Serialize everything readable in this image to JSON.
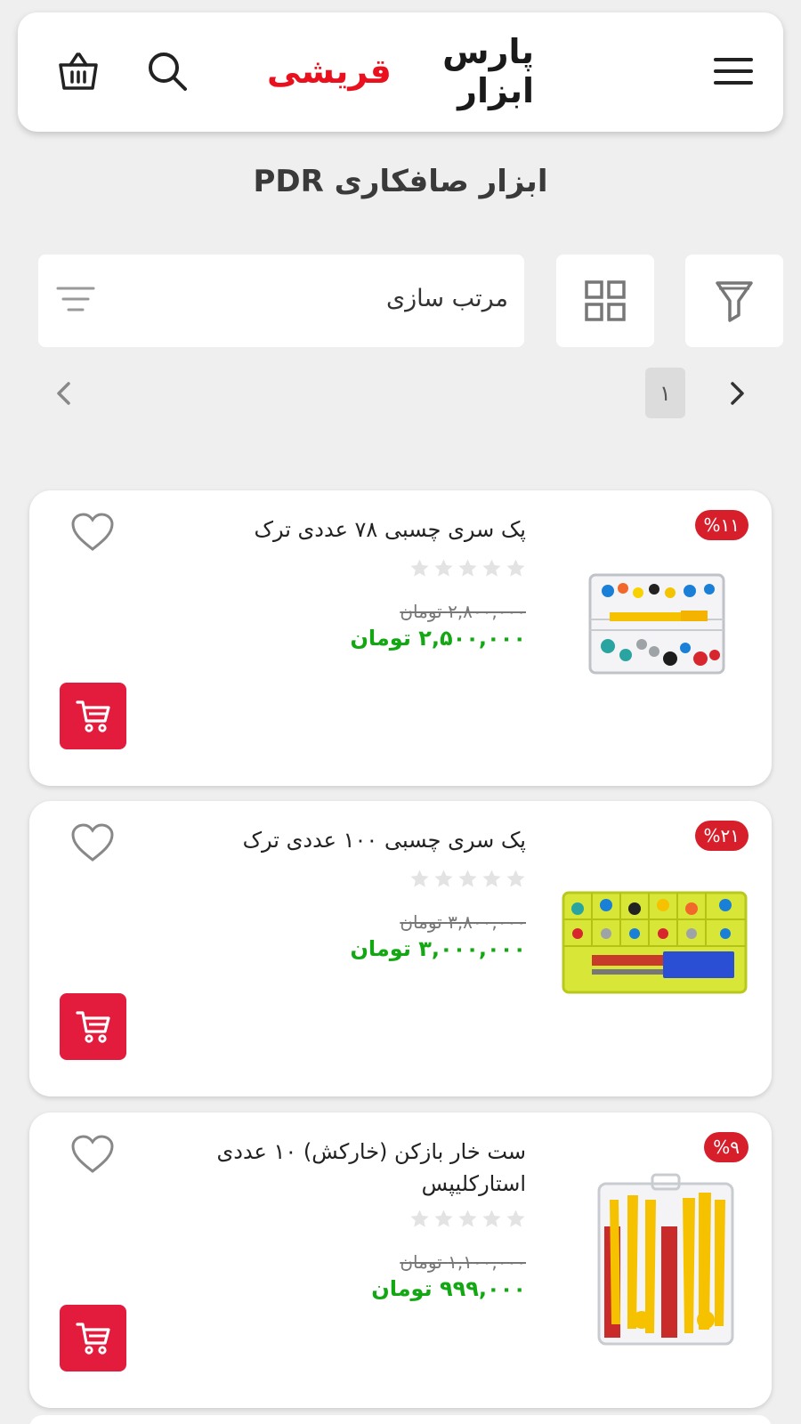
{
  "header": {
    "logo_dark": "پارس ابزار",
    "logo_red": "قریشی",
    "icons": {
      "menu": "hamburger-menu-icon",
      "search": "search-icon",
      "cart": "shopping-basket-icon"
    }
  },
  "page_title": "ابزار صافکاری PDR",
  "toolbar": {
    "sort_label": "مرتب سازی",
    "icons": {
      "filter": "funnel-icon",
      "grid": "grid-view-icon",
      "sort": "sort-lines-icon"
    }
  },
  "pagination": {
    "current_page": "۱"
  },
  "products": [
    {
      "discount": "%۱۱",
      "title": "پک سری چسبی ۷۸ عددی ترک",
      "old_price": "۲,۸۰۰,۰۰۰ تومان",
      "new_price": "۲,۵۰۰,۰۰۰ تومان",
      "rating": 0,
      "image": "clear-case-colored-glue-tabs"
    },
    {
      "discount": "%۲۱",
      "title": "پک سری چسبی ۱۰۰ عددی ترک",
      "old_price": "۳,۸۰۰,۰۰۰ تومان",
      "new_price": "۳,۰۰۰,۰۰۰ تومان",
      "rating": 0,
      "image": "yellow-case-glue-tabs"
    },
    {
      "discount": "%۹",
      "title": "ست خار بازکن (خارکش) ۱۰ عددی استارکلیپس",
      "old_price": "۱,۱۰۰,۰۰۰ تومان",
      "new_price": "۹۹۹,۰۰۰ تومان",
      "rating": 0,
      "image": "yellow-trim-removal-tools"
    }
  ],
  "colors": {
    "accent_red": "#e31b3d",
    "discount_red": "#d71f2b",
    "price_green": "#13a813",
    "background": "#efefef"
  }
}
